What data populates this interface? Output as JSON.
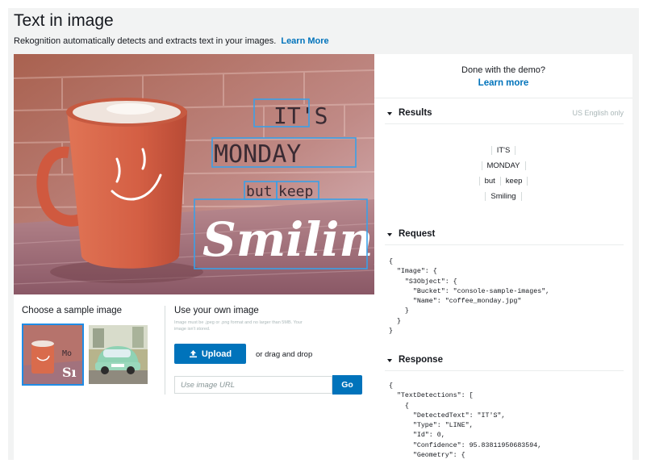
{
  "header": {
    "title": "Text in image",
    "subtitle": "Rekognition automatically detects and extracts text in your images.",
    "learn_more": "Learn More"
  },
  "hero": {
    "overlay_text": [
      "IT'S",
      "MONDAY",
      "but",
      "keep",
      "Smiling"
    ]
  },
  "sample": {
    "title": "Choose a sample image",
    "thumb1_text": [
      "Mo",
      "Sı"
    ]
  },
  "own_image": {
    "title": "Use your own image",
    "hint": "Image must be .jpeg or .png format and no larger than 5MB. Your image isn't stored.",
    "upload_label": "Upload",
    "drag_text": "or drag and drop",
    "url_placeholder": "Use image URL",
    "go_label": "Go"
  },
  "demo": {
    "question": "Done with the demo?",
    "link": "Learn more"
  },
  "results": {
    "title": "Results",
    "note": "US English only",
    "lines": [
      [
        "IT'S"
      ],
      [
        "MONDAY"
      ],
      [
        "but",
        "keep"
      ],
      [
        "Smiling"
      ]
    ]
  },
  "request": {
    "title": "Request",
    "code": "{\n  \"Image\": {\n    \"S3Object\": {\n      \"Bucket\": \"console-sample-images\",\n      \"Name\": \"coffee_monday.jpg\"\n    }\n  }\n}"
  },
  "response": {
    "title": "Response",
    "code": "{\n  \"TextDetections\": [\n    {\n      \"DetectedText\": \"IT'S\",\n      \"Type\": \"LINE\",\n      \"Id\": 0,\n      \"Confidence\": 95.83811950683594,\n      \"Geometry\": {"
  },
  "colors": {
    "accent": "#0073bb",
    "selection": "#1f8ce6",
    "mug": "#d9694a",
    "brick": "#b0665a"
  },
  "icons": [
    "upload-icon",
    "caret-down-icon"
  ]
}
